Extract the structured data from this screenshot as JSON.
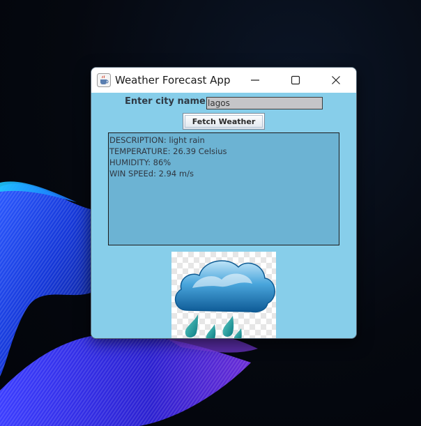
{
  "window": {
    "title": "Weather Forecast App"
  },
  "form": {
    "city_label": "Enter city name:",
    "city_value": "lagos",
    "fetch_label": "Fetch Weather"
  },
  "result": {
    "lines": [
      "DESCRIPTION: light rain",
      "TEMPERATURE: 26.39 Celsius",
      "HUMIDITY: 86%",
      "WIN SPEEd: 2.94 m/s"
    ]
  },
  "icons": {
    "app": "java-coffee-icon",
    "minimize": "minimize-icon",
    "maximize": "maximize-icon",
    "close": "close-icon",
    "weather": "rain-cloud-icon"
  },
  "colors": {
    "content_bg": "#87ceea",
    "result_bg": "#6cb3d3",
    "input_bg": "#c5c5c8",
    "cloud": "#1f7fbf",
    "rain": "#1a9a9a"
  }
}
